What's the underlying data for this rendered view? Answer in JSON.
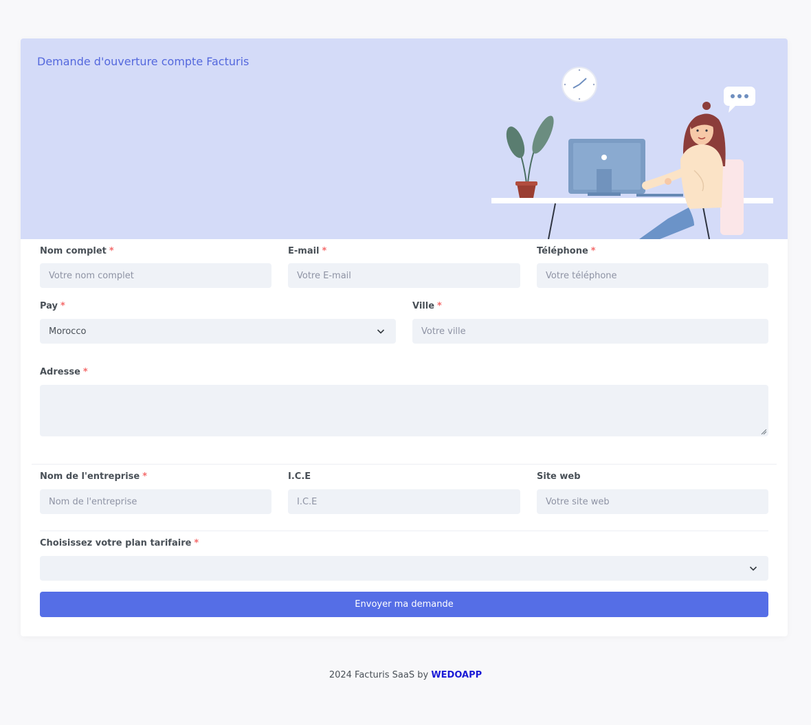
{
  "header": {
    "title": "Demande d'ouverture compte Facturis"
  },
  "form": {
    "full_name": {
      "label": "Nom complet",
      "required": "*",
      "placeholder": "Votre nom complet"
    },
    "email": {
      "label": "E-mail",
      "required": "*",
      "placeholder": "Votre E-mail"
    },
    "phone": {
      "label": "Téléphone",
      "required": "*",
      "placeholder": "Votre téléphone"
    },
    "country": {
      "label": "Pay",
      "required": "*",
      "value": "Morocco"
    },
    "city": {
      "label": "Ville",
      "required": "*",
      "placeholder": "Votre ville"
    },
    "address": {
      "label": "Adresse",
      "required": "*"
    },
    "company": {
      "label": "Nom de l'entreprise",
      "required": "*",
      "placeholder": "Nom de l'entreprise"
    },
    "ice": {
      "label": "I.C.E",
      "placeholder": "I.C.E"
    },
    "website": {
      "label": "Site web",
      "placeholder": "Votre site web"
    },
    "plan": {
      "label": "Choisissez votre plan tarifaire",
      "required": "*",
      "value": ""
    },
    "submit_label": "Envoyer ma demande"
  },
  "footer": {
    "text": "2024 Facturis SaaS by",
    "brand": "WEDOAPP"
  },
  "colors": {
    "accent": "#556ee6",
    "banner": "#d4dbf8",
    "required": "#f46a6a",
    "brand_link": "#1a1ad6"
  }
}
